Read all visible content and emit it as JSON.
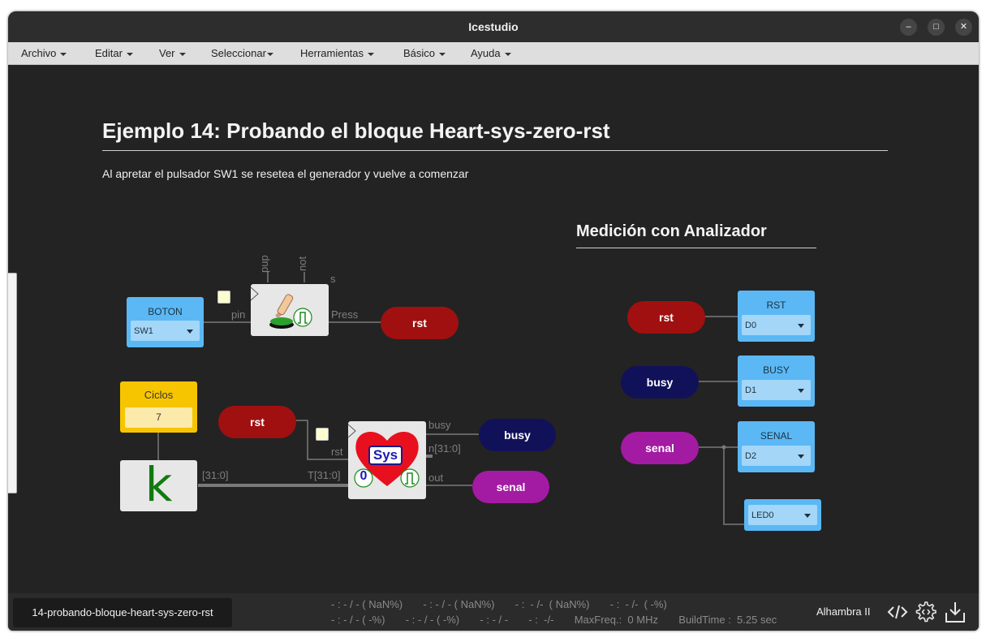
{
  "window": {
    "title": "Icestudio",
    "controls": {
      "minimize": "–",
      "maximize": "□",
      "close": "✕"
    }
  },
  "menu": [
    {
      "label": "Archivo"
    },
    {
      "label": "Editar"
    },
    {
      "label": "Ver"
    },
    {
      "label": "Seleccionar"
    },
    {
      "label": "Herramientas"
    },
    {
      "label": "Básico"
    },
    {
      "label": "Ayuda"
    }
  ],
  "canvas": {
    "heading": "Ejemplo 14: Probando el bloque Heart-sys-zero-rst",
    "description": "Al apretar el pulsador SW1 se resetea el generador y vuelve a comenzar",
    "section_heading": "Medición con Analizador",
    "blocks": {
      "boton": {
        "title": "BOTON",
        "value": "SW1"
      },
      "ciclos": {
        "title": "Ciclos",
        "value": "7"
      },
      "k_symbol": "k",
      "button_module": {
        "ports": {
          "pup": "pup",
          "not": "not",
          "s": "s",
          "pin": "pin",
          "press": "Press"
        }
      },
      "heart_module": {
        "badge": "Sys",
        "zero": "0",
        "ports": {
          "busy": "busy",
          "n": "n[31:0]",
          "rst": "rst",
          "t": "T[31:0]",
          "out": "out"
        }
      },
      "bus_label": "[31:0]",
      "labels": {
        "rst_top": "rst",
        "rst_mid": "rst",
        "busy": "busy",
        "senal": "senal"
      },
      "analyzer": {
        "rst_label": "rst",
        "busy_label": "busy",
        "senal_label": "senal",
        "rst": {
          "title": "RST",
          "value": "D0"
        },
        "busy": {
          "title": "BUSY",
          "value": "D1"
        },
        "senal": {
          "title": "SENAL",
          "value": "D2"
        },
        "led": {
          "value": "LED0"
        }
      }
    }
  },
  "statusbar": {
    "filename": "14-probando-bloque-heart-sys-zero-rst",
    "stats_row1": "- : - / - ( NaN%)       - : - / - ( NaN%)       - :  - /-  ( NaN%)       - :  - /-  ( -%)",
    "stats_row2": "- : - / - ( -%)       - : - / - ( -%)       - : - / -       - :  -/-       MaxFreq.:  0 MHz       BuildTime :  5.25 sec",
    "board": "Alhambra II",
    "icons": [
      "code-icon",
      "settings-gear-icon",
      "download-icon"
    ]
  },
  "colors": {
    "canvas_bg": "#232323",
    "io_block": "#5bb8f5",
    "const_block": "#f7c500",
    "rst_pill": "#a01010",
    "busy_pill": "#11115a",
    "senal_pill": "#a31aa3",
    "heart": "#e8101e"
  }
}
